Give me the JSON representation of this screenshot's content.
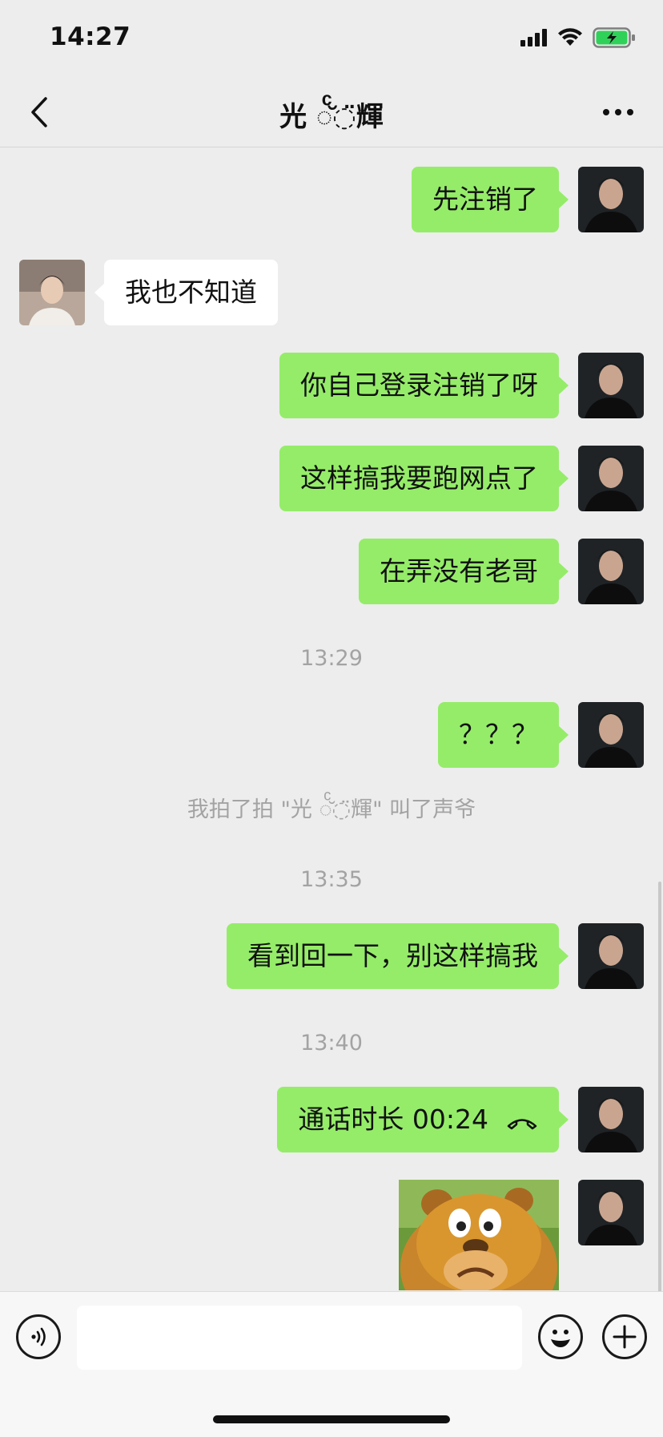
{
  "status_bar": {
    "time": "14:27",
    "icons": [
      "cellular-signal-icon",
      "wifi-icon",
      "battery-charging-icon"
    ],
    "battery_color": "#30d158"
  },
  "nav": {
    "title": "光 ◌ͨ̆◌̈輝",
    "back_icon": "chevron-left-icon",
    "more_icon": "ellipsis-icon"
  },
  "colors": {
    "my_bubble": "#95ec69",
    "other_bubble": "#ffffff",
    "background": "#ededed",
    "meta_text": "#a3a3a3"
  },
  "messages": [
    {
      "sender": "me",
      "text": "先注销了"
    },
    {
      "sender": "other",
      "text": "我也不知道"
    },
    {
      "sender": "me",
      "text": "你自己登录注销了呀"
    },
    {
      "sender": "me",
      "text": "这样搞我要跑网点了"
    },
    {
      "sender": "me",
      "text": "在弄没有老哥"
    },
    {
      "type": "time",
      "text": "13:29"
    },
    {
      "sender": "me",
      "text": "？？？"
    },
    {
      "type": "system",
      "text": "我拍了拍 \"光 ◌ͨ̆◌̈輝\" 叫了声爷"
    },
    {
      "type": "time",
      "text": "13:35"
    },
    {
      "sender": "me",
      "text": "看到回一下，别这样搞我"
    },
    {
      "type": "time",
      "text": "13:40"
    },
    {
      "sender": "me",
      "type": "call",
      "text": "通话时长 00:24",
      "icon": "phone-hangup-icon"
    },
    {
      "sender": "me",
      "type": "sticker",
      "icon": "bear-sticker"
    }
  ],
  "input_bar": {
    "voice_icon": "voice-icon",
    "input_value": "",
    "emoji_icon": "emoji-icon",
    "plus_icon": "plus-icon"
  }
}
